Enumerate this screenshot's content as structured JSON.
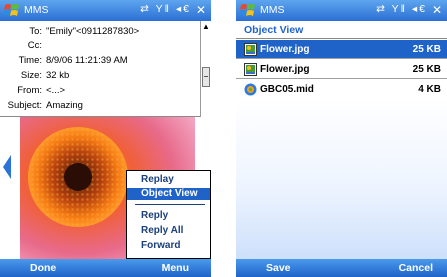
{
  "screen1": {
    "title": "MMS",
    "status_icons": "⇄ Y‖ ◂€",
    "close": "✕",
    "fields": [
      {
        "label": "To:",
        "value": "\"Emily\"<0911287830>"
      },
      {
        "label": "Cc:",
        "value": ""
      },
      {
        "label": "Time:",
        "value": "8/9/06 11:21:39 AM"
      },
      {
        "label": "Size:",
        "value": "32 kb"
      },
      {
        "label": "From:",
        "value": "<...>"
      },
      {
        "label": "Subject:",
        "value": "Amazing"
      }
    ],
    "menu": {
      "items": [
        "Replay",
        "Object View",
        "Reply",
        "Reply All",
        "Forward"
      ],
      "selected": "Object View"
    },
    "softkeys": {
      "left": "Done",
      "right": "Menu"
    }
  },
  "screen2": {
    "title": "MMS",
    "status_icons": "⇄ Y‖ ◂€",
    "close": "✕",
    "heading": "Object View",
    "items": [
      {
        "name": "Flower.jpg",
        "size": "25 KB",
        "icon": "image-icon"
      },
      {
        "name": "Flower.jpg",
        "size": "25 KB",
        "icon": "image-icon"
      },
      {
        "name": "GBC05.mid",
        "size": "4 KB",
        "icon": "media-icon"
      }
    ],
    "selected_index": 0,
    "softkeys": {
      "left": "Save",
      "right": "Cancel"
    }
  },
  "colors": {
    "accent": "#1f63c9",
    "title_bar": "#3a85e3",
    "menu_text": "#1a3f7a"
  }
}
